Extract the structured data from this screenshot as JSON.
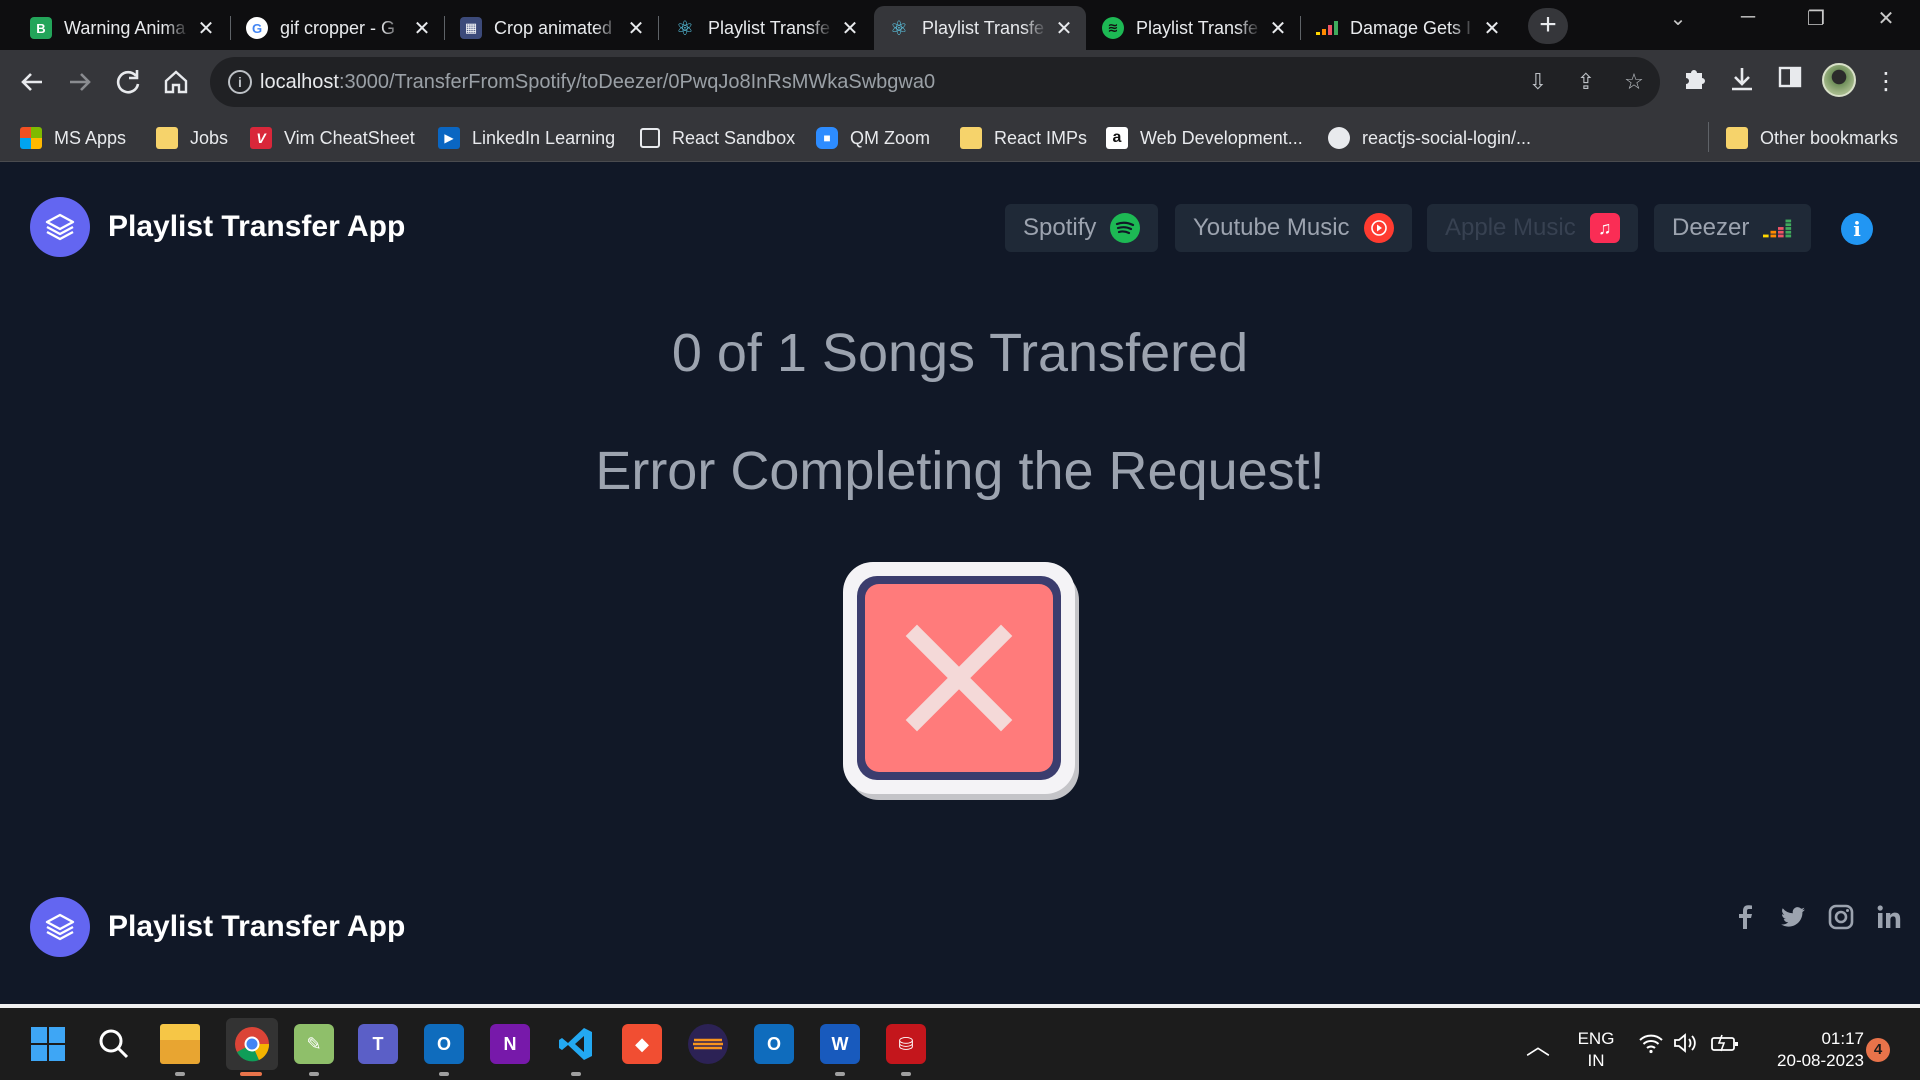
{
  "browser": {
    "tabs": [
      {
        "title": "Warning Anima",
        "favicon_color": "#23a55a",
        "favicon_glyph": "B"
      },
      {
        "title": "gif cropper - G",
        "favicon_color": "#ffffff",
        "favicon_glyph": "G"
      },
      {
        "title": "Crop animated",
        "favicon_color": "#3c4a7a",
        "favicon_glyph": "▦"
      },
      {
        "title": "Playlist Transfe",
        "favicon_color": "#61dafb",
        "favicon_glyph": "⚛"
      },
      {
        "title": "Playlist Transfe",
        "favicon_color": "#61dafb",
        "favicon_glyph": "⚛",
        "active": true
      },
      {
        "title": "Playlist Transfe",
        "favicon_color": "#1db954",
        "favicon_glyph": "≋"
      },
      {
        "title": "Damage Gets I",
        "favicon_color": "#ef5466",
        "favicon_glyph": "▮"
      }
    ],
    "url_host": "localhost",
    "url_path": ":3000/TransferFromSpotify/toDeezer/0PwqJo8InRsMWkaSwbgwa0",
    "bookmarks": [
      {
        "label": "MS Apps",
        "icon": "ms-apps-icon"
      },
      {
        "label": "Jobs",
        "icon": "folder-icon"
      },
      {
        "label": "Vim CheatSheet",
        "icon": "vim-icon"
      },
      {
        "label": "LinkedIn Learning",
        "icon": "linkedin-learning-icon"
      },
      {
        "label": "React Sandbox",
        "icon": "square-icon"
      },
      {
        "label": "QM Zoom",
        "icon": "zoom-icon"
      },
      {
        "label": "React IMPs",
        "icon": "folder-icon"
      },
      {
        "label": "Web Development...",
        "icon": "amazon-icon"
      },
      {
        "label": "reactjs-social-login/...",
        "icon": "github-icon"
      }
    ],
    "other_bookmarks": "Other bookmarks"
  },
  "app": {
    "name": "Playlist Transfer App",
    "services": [
      {
        "label": "Spotify",
        "color": "#1db954"
      },
      {
        "label": "Youtube Music",
        "color": "#ff3b30"
      },
      {
        "label": "Apple Music",
        "color": "#fa2d55"
      },
      {
        "label": "Deezer",
        "color": "#ef5466"
      }
    ],
    "progress_text": "0 of 1 Songs Transfered",
    "songs_transferred": 0,
    "songs_total": 1,
    "error_text": "Error Completing the Request!",
    "error_color": "#ff7b7b",
    "footer_name": "Playlist Transfer App",
    "socials": [
      "facebook-icon",
      "twitter-icon",
      "instagram-icon",
      "linkedin-icon"
    ]
  },
  "taskbar": {
    "language": "ENG",
    "region": "IN",
    "time": "01:17",
    "date": "20-08-2023",
    "notifications": "4"
  }
}
